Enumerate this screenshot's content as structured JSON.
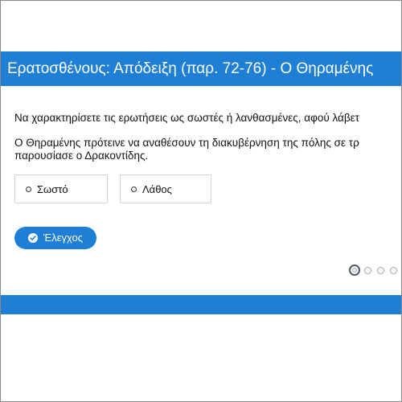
{
  "header": {
    "title": "Ερατοσθένους: Απόδειξη (παρ. 72-76) - Ο Θηραμένης"
  },
  "exercise": {
    "instructions": "Να χαρακτηρίσετε τις ερωτήσεις ως σωστές ή λανθασμένες, αφού λάβετ",
    "question_line1": "Ο Θηραμένης πρότεινε να αναθέσουν τη διακυβέρνηση της πόλης σε τρ",
    "question_line2": "παρουσίασε ο Δρακοντίδης."
  },
  "options": {
    "true_label": "Σωστό",
    "false_label": "Λάθος"
  },
  "actions": {
    "check_label": "Έλεγχος"
  },
  "pager": {
    "total": 4,
    "current": 1
  },
  "colors": {
    "accent": "#1e7fd4"
  }
}
